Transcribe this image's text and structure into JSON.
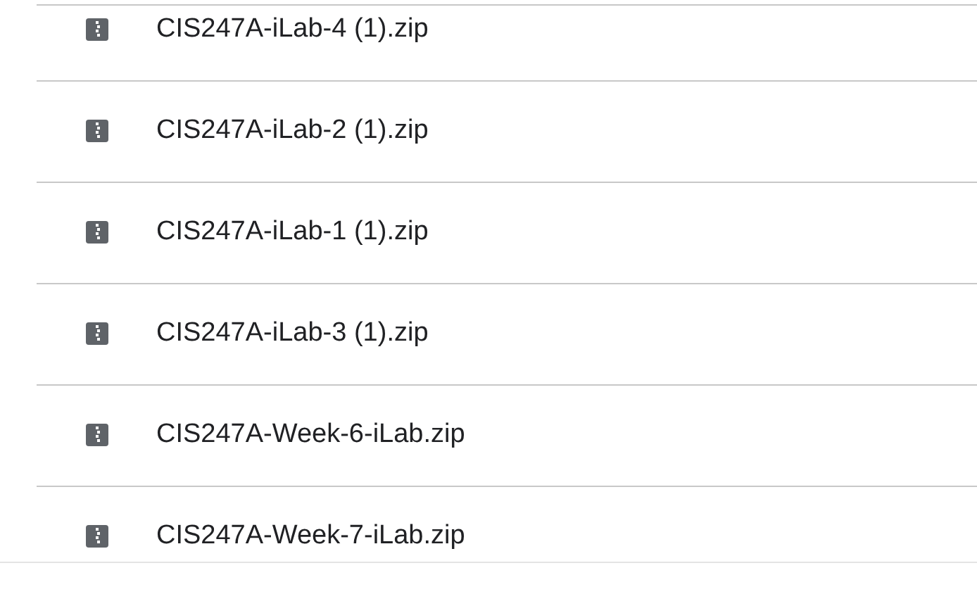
{
  "files": [
    {
      "name": "CIS247A-iLab-4 (1).zip"
    },
    {
      "name": "CIS247A-iLab-2 (1).zip"
    },
    {
      "name": "CIS247A-iLab-1 (1).zip"
    },
    {
      "name": "CIS247A-iLab-3 (1).zip"
    },
    {
      "name": "CIS247A-Week-6-iLab.zip"
    },
    {
      "name": "CIS247A-Week-7-iLab.zip"
    }
  ]
}
